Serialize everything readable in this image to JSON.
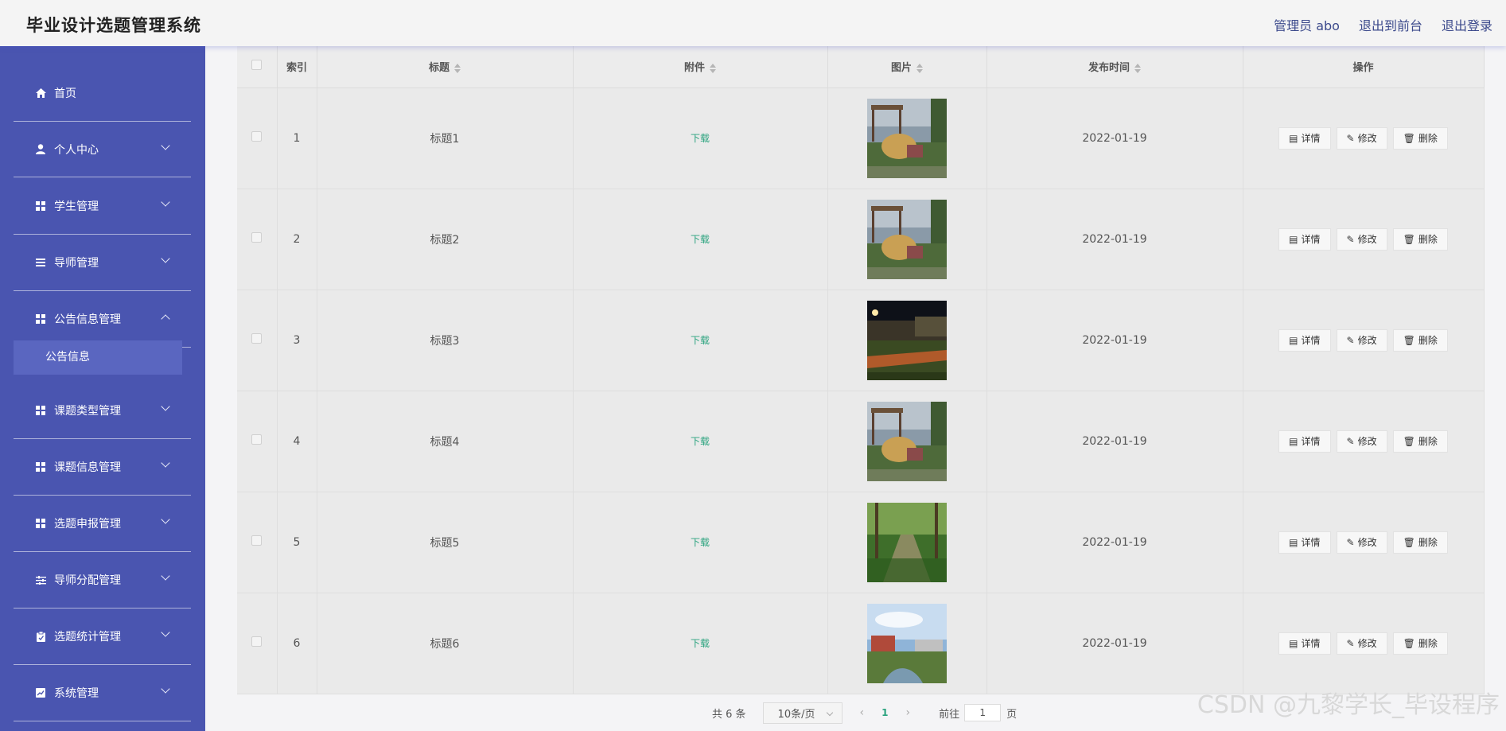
{
  "app_title": "毕业设计选题管理系统",
  "top_links": [
    "管理员 abo",
    "退出到前台",
    "退出登录"
  ],
  "sidebar": {
    "items": [
      {
        "label": "首页",
        "icon": "home-icon"
      },
      {
        "label": "个人中心",
        "icon": "user-icon"
      },
      {
        "label": "学生管理",
        "icon": "grid-icon"
      },
      {
        "label": "导师管理",
        "icon": "list-icon"
      },
      {
        "label": "公告信息管理",
        "icon": "grid-icon"
      },
      {
        "label": "课题类型管理",
        "icon": "grid-icon"
      },
      {
        "label": "课题信息管理",
        "icon": "grid-icon"
      },
      {
        "label": "选题申报管理",
        "icon": "grid-icon"
      },
      {
        "label": "导师分配管理",
        "icon": "sliders-icon"
      },
      {
        "label": "选题统计管理",
        "icon": "clipboard-icon"
      },
      {
        "label": "系统管理",
        "icon": "chart-icon"
      }
    ],
    "active_sub": "公告信息"
  },
  "table": {
    "headers": [
      "索引",
      "标题",
      "附件",
      "图片",
      "发布时间",
      "操作"
    ],
    "rows": [
      {
        "index": "1",
        "title": "标题1",
        "attachment": "下载",
        "image": "pavilion-statue",
        "date": "2022-01-19"
      },
      {
        "index": "2",
        "title": "标题2",
        "attachment": "下载",
        "image": "pavilion-statue",
        "date": "2022-01-19"
      },
      {
        "index": "3",
        "title": "标题3",
        "attachment": "下载",
        "image": "night-stadium",
        "date": "2022-01-19"
      },
      {
        "index": "4",
        "title": "标题4",
        "attachment": "下载",
        "image": "pavilion-statue",
        "date": "2022-01-19"
      },
      {
        "index": "5",
        "title": "标题5",
        "attachment": "下载",
        "image": "tree-lined-path",
        "date": "2022-01-19"
      },
      {
        "index": "6",
        "title": "标题6",
        "attachment": "下载",
        "image": "campus-aerial",
        "date": "2022-01-19"
      }
    ],
    "actions": [
      "详情",
      "修改",
      "删除"
    ]
  },
  "pagination": {
    "total": "共 6 条",
    "page_size": "10条/页",
    "current_page": "1",
    "goto_label": "前往",
    "goto_value": "1",
    "page_suffix": "页"
  },
  "watermark": "CSDN @九黎学长_毕设程序",
  "colors": {
    "sidebar": "#4a55b0",
    "accent": "#2aa37e",
    "header_link": "#3c4a8c"
  }
}
